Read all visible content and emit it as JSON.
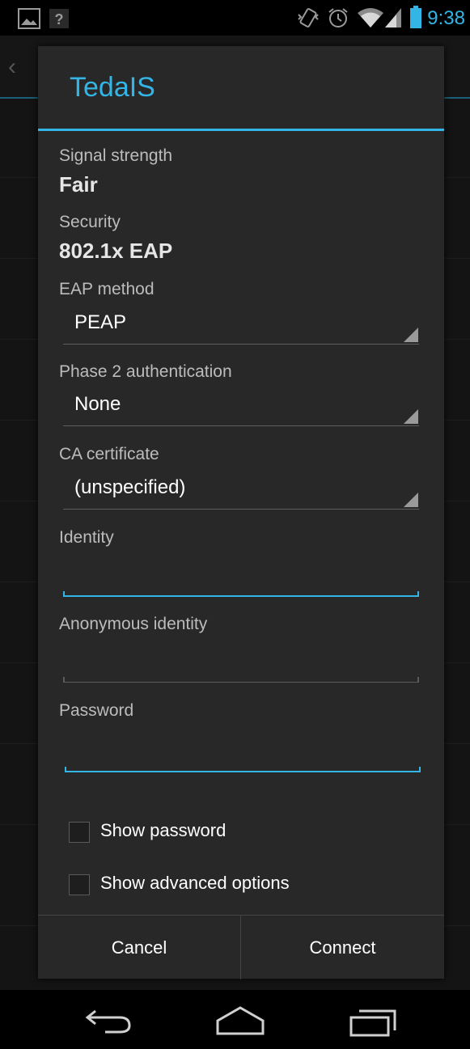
{
  "status_bar": {
    "time": "9:38",
    "accent_color": "#33b5e5",
    "icons": [
      "gallery-notification-icon",
      "unknown-notification-icon",
      "vibrate-icon",
      "alarm-icon",
      "wifi-icon",
      "cell-signal-icon",
      "battery-icon"
    ]
  },
  "dialog": {
    "title": "TedaIS",
    "signal_label": "Signal strength",
    "signal_value": "Fair",
    "security_label": "Security",
    "security_value": "802.1x EAP",
    "eap_label": "EAP method",
    "eap_value": "PEAP",
    "phase2_label": "Phase 2 authentication",
    "phase2_value": "None",
    "ca_label": "CA certificate",
    "ca_value": "(unspecified)",
    "identity_label": "Identity",
    "identity_value": "",
    "anon_label": "Anonymous identity",
    "anon_value": "",
    "password_label": "Password",
    "password_value": "",
    "show_password_label": "Show password",
    "show_password_checked": false,
    "show_advanced_label": "Show advanced options",
    "show_advanced_checked": false,
    "cancel_label": "Cancel",
    "connect_label": "Connect"
  },
  "navigation_bar": {
    "icons": [
      "back-icon",
      "home-icon",
      "recent-apps-icon"
    ]
  }
}
